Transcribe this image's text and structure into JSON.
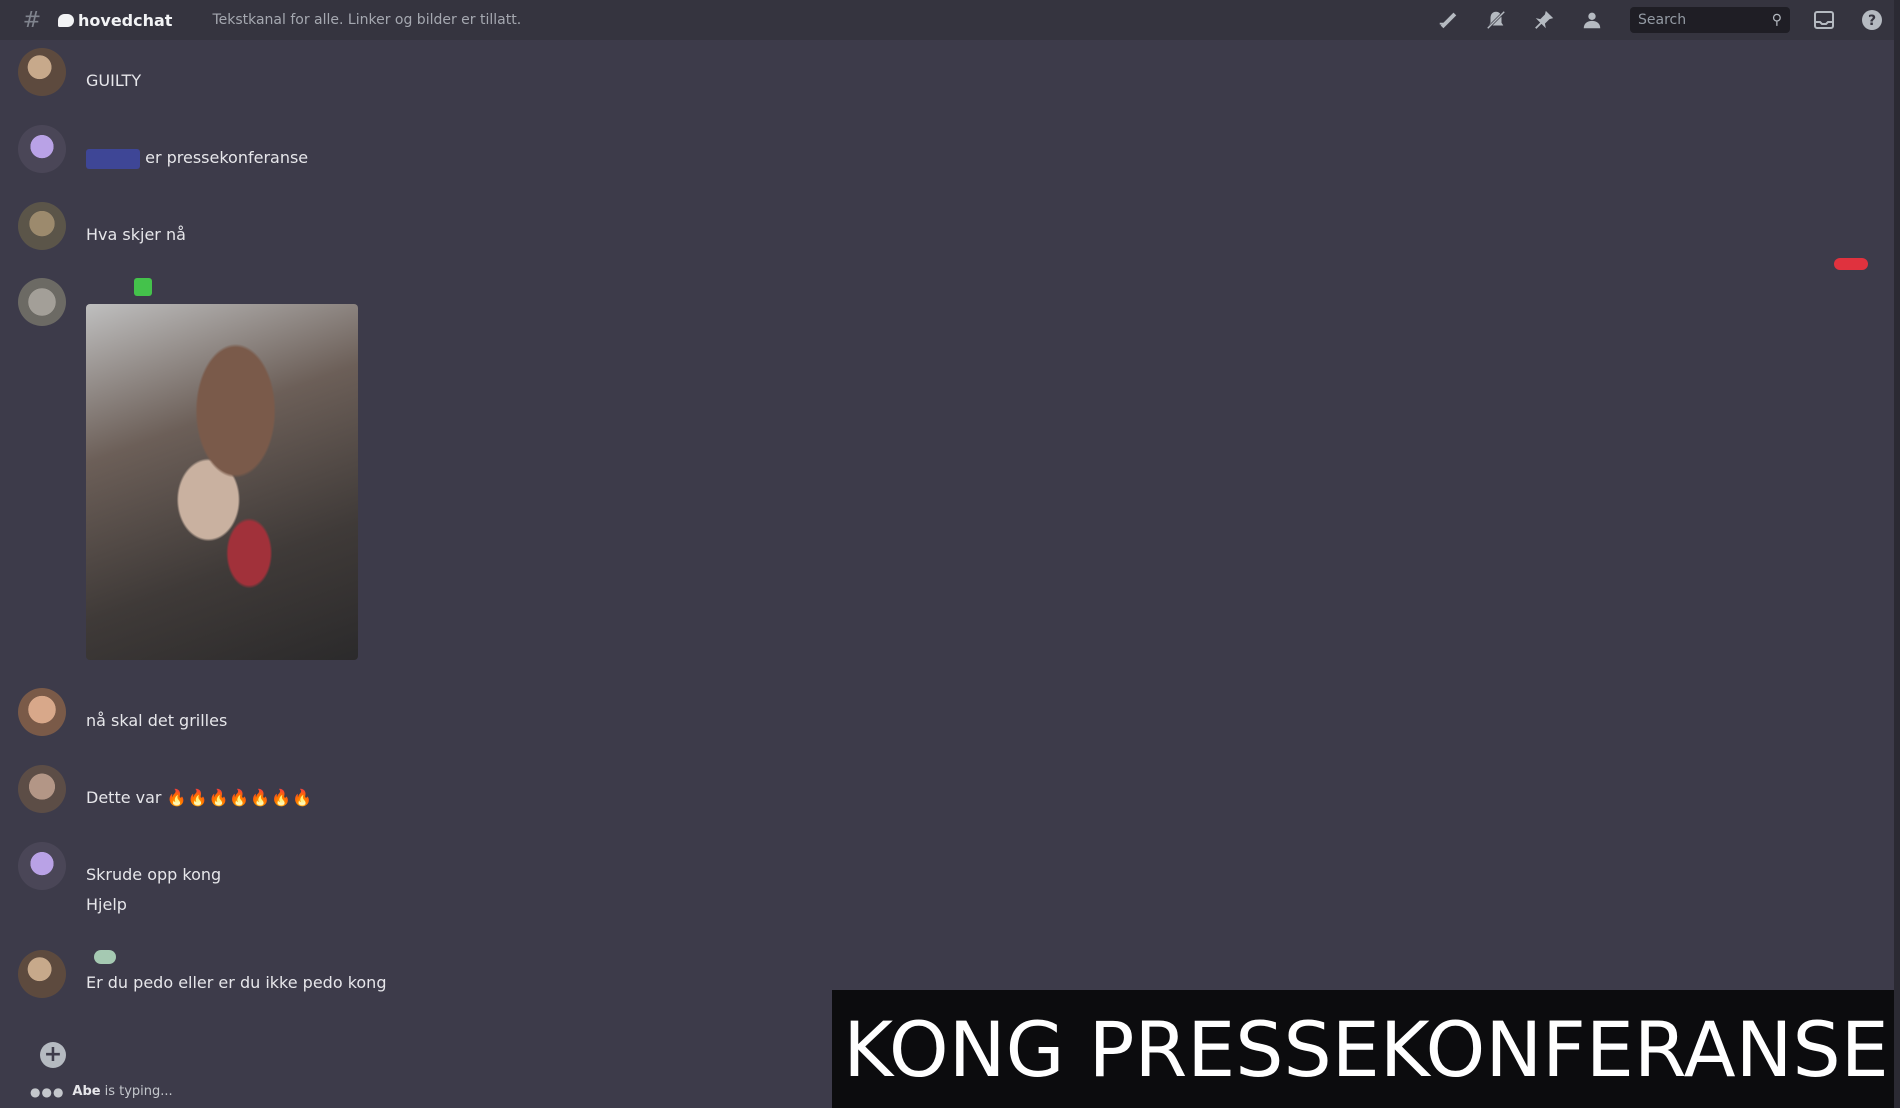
{
  "header": {
    "channel_icon": "hash-icon",
    "channel_name": "hovedchat",
    "topic": "Tekstkanal for alle. Linker og bilder er tillatt.",
    "search_placeholder": "Search",
    "icons": [
      "threads-icon",
      "mute-icon",
      "pin-icon",
      "members-icon",
      "inbox-icon",
      "help-icon"
    ]
  },
  "messages": [
    {
      "author": "",
      "timestamp": "",
      "lines": [
        "GUILTY"
      ]
    },
    {
      "author": "",
      "timestamp": "",
      "mention": "",
      "lines": [
        "er pressekonferanse"
      ]
    },
    {
      "author": "",
      "timestamp": "",
      "lines": [
        "Hva skjer nå"
      ]
    },
    {
      "author": "",
      "timestamp": "",
      "has_image": true
    },
    {
      "author": "",
      "timestamp": "",
      "lines": [
        "nå skal det grilles"
      ]
    },
    {
      "author": "",
      "timestamp": "",
      "lines": [
        "Dette var",
        "🔥🔥🔥🔥🔥🔥🔥"
      ]
    },
    {
      "author": "",
      "timestamp": "",
      "lines": [
        "Skrude opp kong",
        "Hjelp"
      ]
    },
    {
      "author": "",
      "timestamp": "",
      "lines": [
        "Er du pedo eller er du ikke pedo kong"
      ]
    }
  ],
  "composer": {
    "placeholder": ""
  },
  "typing": {
    "user": "Abe",
    "suffix": "is typing..."
  },
  "caption": "KONG PRESSEKONFERANSE",
  "colors": {
    "background": "#3d3b4a",
    "header": "#35343f",
    "mention": "#3e4696",
    "unread": "#e0323e"
  }
}
